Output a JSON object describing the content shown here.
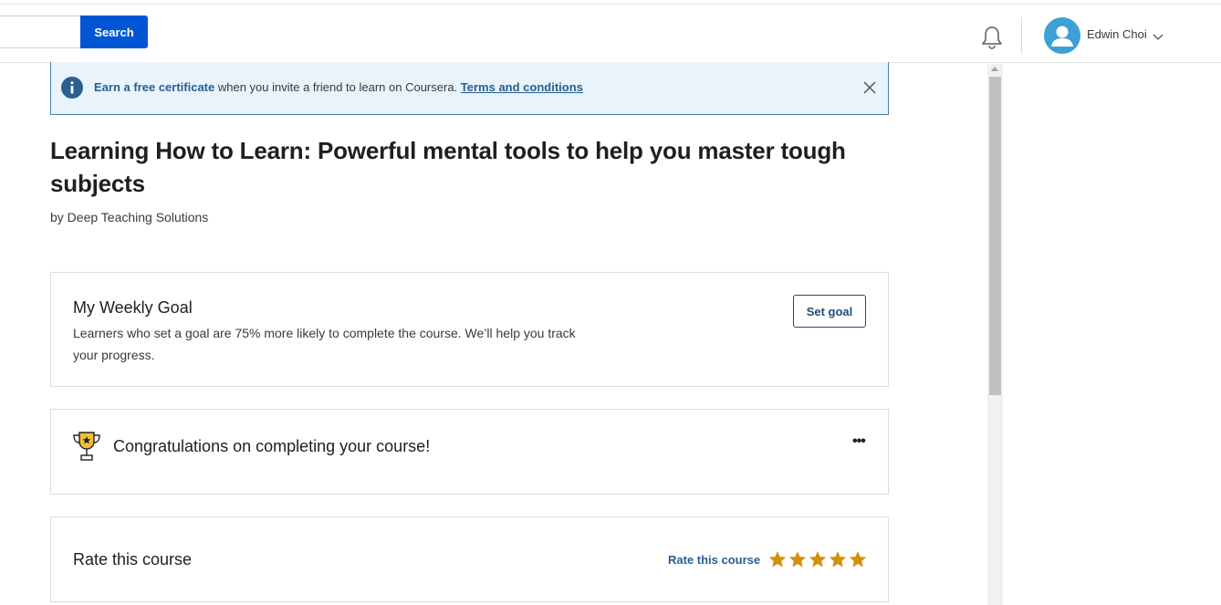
{
  "header": {
    "search_placeholder": "",
    "search_button_label": "Search",
    "user_name": "Edwin Choi",
    "icons": [
      "bell-icon",
      "avatar-icon",
      "chevron-down-icon"
    ]
  },
  "banner": {
    "strong_text": "Earn a free certificate",
    "middle_text": " when you invite a friend to learn on Coursera. ",
    "link_text": "Terms and conditions",
    "icons": [
      "info-icon",
      "close-icon"
    ]
  },
  "course": {
    "title": "Learning How to Learn: Powerful mental tools to help you master tough subjects",
    "author": "by Deep Teaching Solutions"
  },
  "weekly_goal": {
    "title": "My Weekly Goal",
    "description": "Learners who set a goal are 75% more likely to complete the course. We’ll help you track your progress.",
    "button_label": "Set goal"
  },
  "completion": {
    "message": "Congratulations on completing your course!",
    "more_label": "•••",
    "icon": "trophy-icon"
  },
  "rating": {
    "title": "Rate this course",
    "link_label": "Rate this course",
    "stars_total": 5,
    "stars_filled": 5
  },
  "colors": {
    "brand_blue": "#0056d2",
    "banner_bg": "#e8f3fc",
    "link_blue": "#2a5f8f",
    "star_gold": "#d4900a",
    "avatar_blue": "#3da0d6"
  }
}
